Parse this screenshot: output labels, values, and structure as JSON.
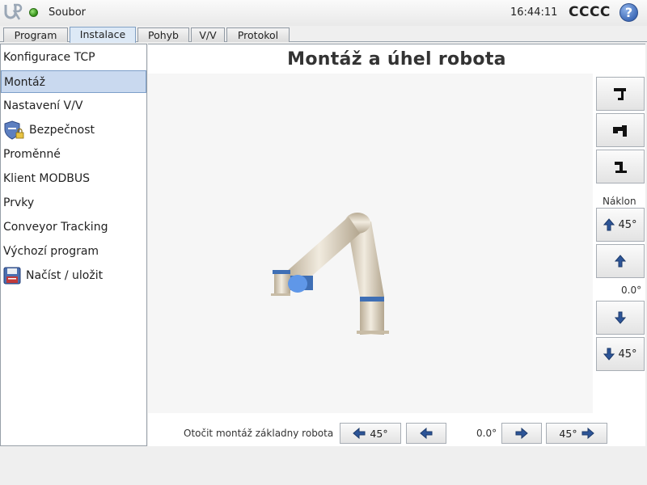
{
  "header": {
    "file_label": "Soubor",
    "time": "16:44:11",
    "robot_name": "CCCC",
    "help_label": "?"
  },
  "tabs": [
    {
      "label": "Program"
    },
    {
      "label": "Instalace"
    },
    {
      "label": "Pohyb"
    },
    {
      "label": "V/V"
    },
    {
      "label": "Protokol"
    }
  ],
  "nav": {
    "items": [
      {
        "label": "Konfigurace TCP"
      },
      {
        "label": "Montáž"
      },
      {
        "label": "Nastavení V/V"
      },
      {
        "label": "Bezpečnost"
      },
      {
        "label": "Proměnné"
      },
      {
        "label": "Klient MODBUS"
      },
      {
        "label": "Prvky"
      },
      {
        "label": "Conveyor Tracking"
      },
      {
        "label": "Výchozí program"
      },
      {
        "label": "Načíst / uložit"
      }
    ]
  },
  "main": {
    "title": "Montáž a úhel robota",
    "tilt_label": "Náklon",
    "tilt_up_45": "45°",
    "tilt_value": "0.0°",
    "tilt_down_45": "45°",
    "rotate_label": "Otočit montáž základny robota",
    "rotate_left_45": "45°",
    "rotate_value": "0.0°",
    "rotate_right_45": "45°"
  }
}
